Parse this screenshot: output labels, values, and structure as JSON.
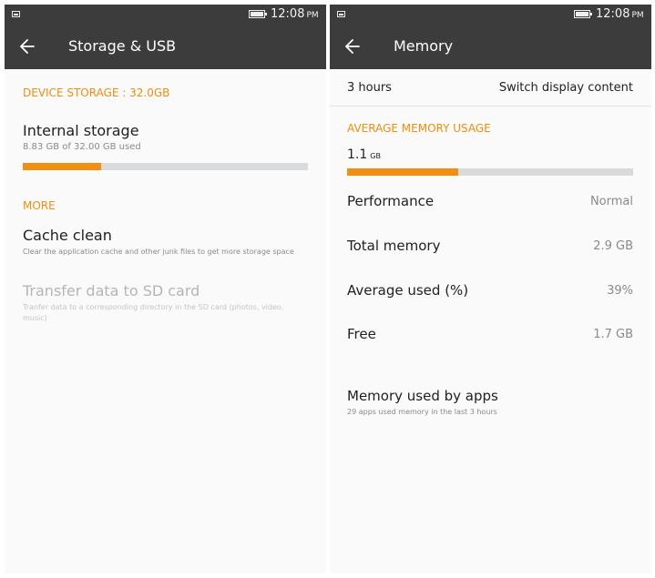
{
  "status_bar": {
    "time": "12:08",
    "ampm": "PM"
  },
  "left": {
    "title": "Storage & USB",
    "device_storage_header": "DEVICE STORAGE : 32.0GB",
    "internal_storage": {
      "label": "Internal storage",
      "usage_text": "8.83 GB of 32.00 GB used",
      "used_fraction": 0.276
    },
    "more_header": "MORE",
    "cache_clean": {
      "label": "Cache clean",
      "description": "Clear the application cache and other junk files to get more storage space"
    },
    "transfer": {
      "label": "Transfer data to SD card",
      "description": "Tranfer data to a corresponding directory in the SD card (photos, video, music)",
      "enabled": false
    }
  },
  "right": {
    "title": "Memory",
    "duration": "3 hours",
    "switch_label": "Switch display content",
    "avg_usage_header": "AVERAGE MEMORY USAGE",
    "avg_value": "1.1",
    "avg_unit": "GB",
    "usage_fraction": 0.39,
    "stats": [
      {
        "label": "Performance",
        "value": "Normal"
      },
      {
        "label": "Total memory",
        "value": "2.9 GB"
      },
      {
        "label": "Average used (%)",
        "value": "39%"
      },
      {
        "label": "Free",
        "value": "1.7 GB"
      }
    ],
    "apps": {
      "label": "Memory used by apps",
      "description": "29 apps used memory in the last 3 hours"
    }
  },
  "colors": {
    "accent": "#ef8d0e",
    "app_bar": "#3c3c3c",
    "bar_track": "#d8dadb",
    "background": "#fafafa"
  },
  "icons": [
    "image-icon",
    "battery-icon",
    "back-arrow-icon"
  ]
}
